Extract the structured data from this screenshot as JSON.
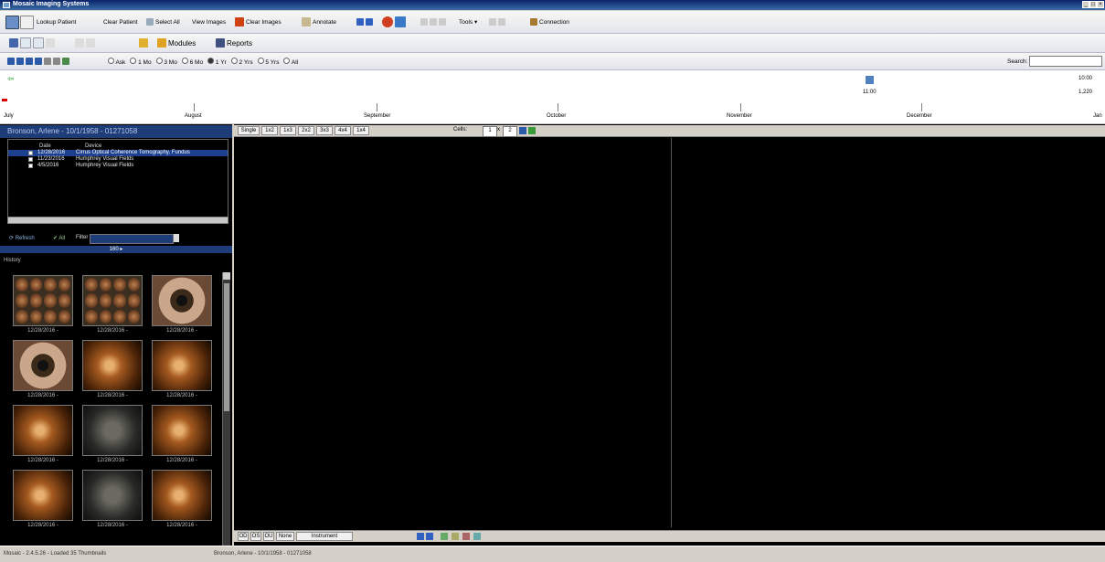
{
  "window": {
    "title": "Mosaic Imaging Systems",
    "min": "_",
    "max": "□",
    "close": "×"
  },
  "toolbar1": {
    "lookup_patient": "Lookup Patient",
    "clear_patient": "Clear Patient",
    "select_all": "Select All",
    "view_images": "View Images",
    "clear_images": "Clear Images",
    "annotate": "Annotate",
    "tools": "Tools ▾",
    "connection": "Connection"
  },
  "toolbar2": {
    "modules": "Modules",
    "reports": "Reports"
  },
  "toolbar3": {
    "filters": [
      "Ask",
      "1 Mo",
      "3 Mo",
      "6 Mo",
      "1 Yr",
      "2 Yrs",
      "5 Yrs",
      "All"
    ],
    "search_label": "Search:",
    "search_value": ""
  },
  "timeline": {
    "labels": [
      "July",
      "August",
      "September",
      "October",
      "November",
      "December",
      "Jan"
    ],
    "right_top": "10:00",
    "right_mid": "1,220",
    "mid_value": "11:00"
  },
  "patient": {
    "header": "Bronson, Arlene - 10/1/1958 - 01271058",
    "col_date": "Date",
    "col_device": "Device",
    "studies": [
      {
        "date": "12/28/2016",
        "device": "Cirrus Optical Coherence Tomography, Fundus",
        "selected": true
      },
      {
        "date": "11/23/2016",
        "device": "Humphrey Visual Fields",
        "selected": false
      },
      {
        "date": "4/5/2016",
        "device": "Humphrey Visual Fields",
        "selected": false
      }
    ],
    "refresh": "Refresh",
    "all": "All",
    "filter_label": "Filter",
    "count_bar": "160 ▸",
    "history_label": "History"
  },
  "thumbnails": [
    {
      "label": "12/28/2016 -",
      "kind": "grid"
    },
    {
      "label": "12/28/2016 -",
      "kind": "grid"
    },
    {
      "label": "12/28/2016 -",
      "kind": "eye"
    },
    {
      "label": "12/28/2016 -",
      "kind": "eye"
    },
    {
      "label": "12/28/2016 -",
      "kind": "fundus"
    },
    {
      "label": "12/28/2016 -",
      "kind": "fundus"
    },
    {
      "label": "12/28/2016 -",
      "kind": "fundus"
    },
    {
      "label": "12/28/2016 -",
      "kind": "dark"
    },
    {
      "label": "12/28/2016 -",
      "kind": "fundus"
    },
    {
      "label": "12/28/2016 -",
      "kind": "fundus"
    },
    {
      "label": "12/28/2016 -",
      "kind": "dark"
    },
    {
      "label": "12/28/2016 -",
      "kind": "fundus"
    }
  ],
  "viewer": {
    "layouts": [
      "Single",
      "1x2",
      "1x3",
      "2x2",
      "3x3",
      "4x4",
      "1x4"
    ],
    "cells_label": "Cells:",
    "cells_x": "1",
    "cells_y": "2",
    "bottom_buttons": [
      "OD",
      "OS",
      "OU",
      "None",
      "Instrument"
    ]
  },
  "status": {
    "left": "Mosaic - 2.4.5.26 - Loaded 35 Thumbnails",
    "middle": "Bronson, Arlene - 10/1/1958 - 01271058"
  }
}
